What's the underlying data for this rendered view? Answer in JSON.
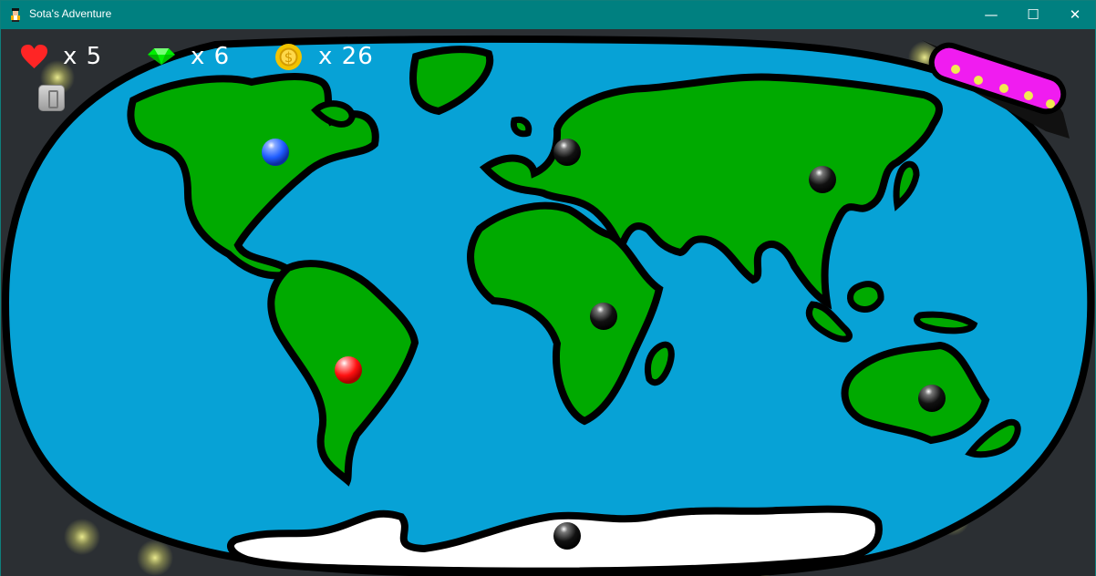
{
  "window": {
    "title": "Sota's Adventure",
    "controls": {
      "minimize": "—",
      "maximize": "☐",
      "close": "✕"
    }
  },
  "hud": {
    "lives": "x 5",
    "gems": "x 6",
    "coins": "x 26"
  },
  "colors": {
    "titlebar": "#008080",
    "ocean": "#07a2d6",
    "land": "#00aa00",
    "outline": "#000000",
    "space": "#2b2f33",
    "ship": "#f01cf0",
    "blue_node": "#1f5dff",
    "red_node": "#ff1111",
    "locked_node": "#111111"
  },
  "icons": {
    "app": "character-icon",
    "lives": "heart-icon",
    "gems": "gem-icon",
    "coins": "coin-icon",
    "exit": "exit-door-icon",
    "ship": "airship-icon"
  }
}
